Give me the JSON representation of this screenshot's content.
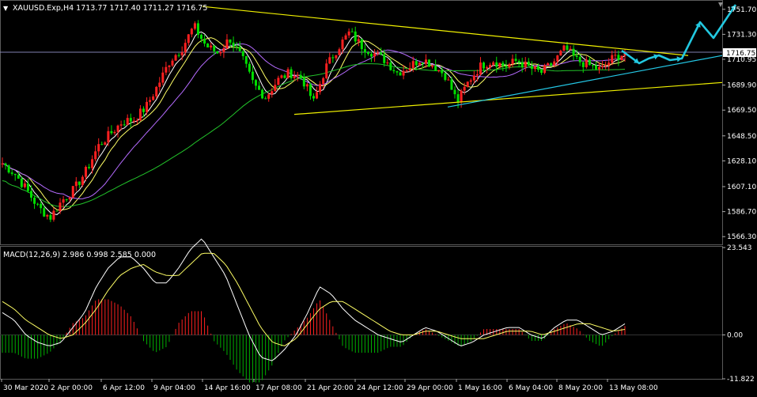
{
  "window": {
    "symbol_line": "XAUUSD.Exp,H4  1713.77 1717.40 1711.27 1716.75",
    "current_price_tag": "1716.75",
    "macd_label": "MACD(12,26,9) 2.986 0.998 2.585 0.000"
  },
  "colors": {
    "background": "#000000",
    "grid": "#2a2a2a",
    "bull": "#ff2020",
    "bear": "#00e000",
    "wick_bull": "#ff2020",
    "wick_bear": "#00e000",
    "ma_fast": "#ffffff",
    "ma_mid": "#ffff66",
    "ma_slow": "#b56bff",
    "ma_long": "#22c22a",
    "trend_yellow": "#f0f000",
    "trend_cyan": "#24c8e6",
    "arrows": "#22c8e0",
    "price_line": "#8080b0",
    "macd_line": "#ffffff",
    "signal_line": "#ffff66",
    "hist_pos": "#ff2020",
    "hist_neg": "#00b000"
  },
  "icons": {
    "chart_arrow": "chart-arrow-icon",
    "scroll_marker": "shift-marker-icon"
  },
  "chart_data": [
    {
      "type": "candlestick",
      "title": "XAUUSD.Exp,H4",
      "ylim": [
        1560,
        1758
      ],
      "y_ticks": [
        "1751.70",
        "1731.30",
        "1710.95",
        "1689.90",
        "1669.50",
        "1648.50",
        "1628.10",
        "1607.10",
        "1586.70",
        "1566.30"
      ],
      "x_ticks": [
        "30 Mar 2020",
        "2 Apr 00:00",
        "6 Apr 12:00",
        "9 Apr 04:00",
        "14 Apr 16:00",
        "17 Apr 08:00",
        "21 Apr 20:00",
        "24 Apr 12:00",
        "29 Apr 00:00",
        "1 May 16:00",
        "6 May 04:00",
        "8 May 20:00",
        "13 May 08:00"
      ],
      "last_price": 1716.75,
      "close_path": [
        1626,
        1618,
        1605,
        1590,
        1582,
        1596,
        1605,
        1620,
        1640,
        1650,
        1660,
        1662,
        1672,
        1690,
        1710,
        1720,
        1738,
        1722,
        1716,
        1728,
        1712,
        1690,
        1680,
        1694,
        1700,
        1696,
        1676,
        1704,
        1720,
        1733,
        1722,
        1716,
        1710,
        1700,
        1705,
        1712,
        1706,
        1698,
        1676,
        1694,
        1706,
        1710,
        1705,
        1710,
        1704,
        1700,
        1708,
        1720,
        1710,
        1706,
        1702,
        1712,
        1716
      ],
      "trendlines": [
        {
          "name": "upper-resistance",
          "from": [
            "14 Apr 16:00",
            1754
          ],
          "to": [
            "end",
            1714
          ]
        },
        {
          "name": "lower-support",
          "from": [
            "17 Apr 08:00",
            1666
          ],
          "to": [
            "end",
            1692
          ]
        },
        {
          "name": "rising-support",
          "from": [
            "29 Apr 00:00",
            1672
          ],
          "to": [
            "end",
            1714
          ]
        }
      ]
    },
    {
      "type": "macd",
      "title": "MACD(12,26,9)",
      "ylim": [
        -11.822,
        23.543
      ],
      "y_ticks": [
        "23.543",
        "0.00",
        "-11.822"
      ],
      "macd": [
        6,
        4,
        0,
        -2,
        -3,
        -2,
        2,
        6,
        13,
        18,
        21,
        21,
        18,
        14,
        14,
        18,
        23,
        26,
        21,
        16,
        8,
        0,
        -6,
        -7,
        -4,
        0,
        6,
        13,
        11,
        7,
        4,
        2,
        0,
        -1,
        -2,
        0,
        2,
        1,
        -1,
        -3,
        -2,
        0,
        1,
        2,
        2,
        0,
        -1,
        2,
        4,
        4,
        2,
        0,
        1,
        3
      ],
      "signal": [
        9,
        7,
        4,
        2,
        0,
        -1,
        0,
        3,
        7,
        12,
        16,
        18,
        19,
        17,
        16,
        16,
        19,
        22,
        22,
        19,
        14,
        8,
        2,
        -2,
        -3,
        -1,
        3,
        7,
        9,
        9,
        7,
        5,
        3,
        1,
        0,
        0,
        1,
        1,
        0,
        -1,
        -1,
        -1,
        0,
        1,
        1,
        1,
        0,
        1,
        2,
        3,
        3,
        2,
        1,
        1.5
      ]
    }
  ]
}
